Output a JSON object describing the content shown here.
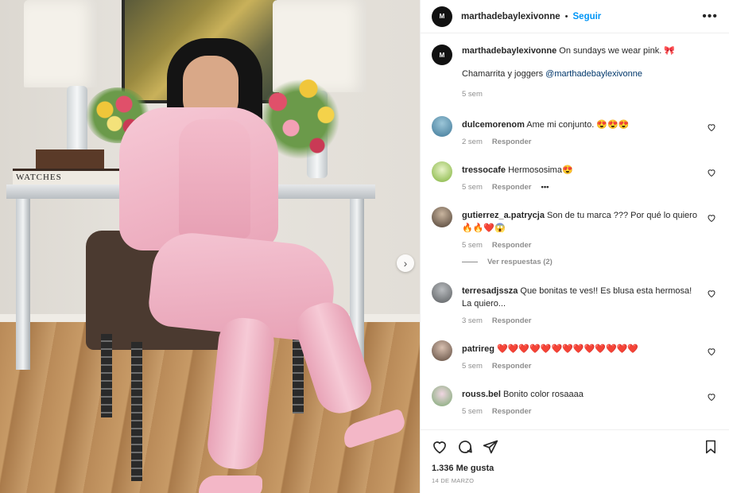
{
  "post": {
    "username": "marthadebaylexivonne",
    "follow_label": "Seguir",
    "separator": "•",
    "avatar_text": "M",
    "more_label": "•••",
    "image_books_text": "WATCHES"
  },
  "caption": {
    "username": "marthadebaylexivonne",
    "text": " On sundays we wear pink. 🎀",
    "line2": "Chamarrita y joggers ",
    "mention": "@marthadebaylexivonne",
    "time": "5 sem"
  },
  "comments": [
    {
      "user": "dulcemorenom",
      "text": " Ame mi conjunto. 😍😍😍",
      "time": "2 sem",
      "reply": "Responder",
      "avatar_color": "#4f8fb0"
    },
    {
      "user": "tressocafe",
      "text": " Hermososima😍",
      "time": "5 sem",
      "reply": "Responder",
      "extra": "•••",
      "avatar_color": "#8cbf3f"
    },
    {
      "user": "gutierrez_a.patrycja",
      "text": " Son de tu marca ??? Por qué lo quiero🔥🔥❤️😱",
      "time": "5 sem",
      "reply": "Responder",
      "avatar_color": "#6b5a4a"
    },
    {
      "user": "terresadjssza",
      "text": " Que bonitas te ves!! Es blusa esta hermosa! La quiero...",
      "time": "3 sem",
      "reply": "Responder",
      "avatar_color": "#7a7d80"
    },
    {
      "user": "patrireg",
      "text": " ❤️❤️❤️❤️❤️❤️❤️❤️❤️❤️❤️❤️❤️",
      "time": "5 sem",
      "reply": "Responder",
      "avatar_color": "#9a8070"
    },
    {
      "user": "rouss.bel",
      "text": " Bonito color rosaaaa",
      "time": "5 sem",
      "reply": "Responder",
      "avatar_color": "#a8c9a0"
    }
  ],
  "view_replies": "Ver respuestas (2)",
  "footer": {
    "likes": "1.336 Me gusta",
    "date": "14 DE MARZO"
  }
}
